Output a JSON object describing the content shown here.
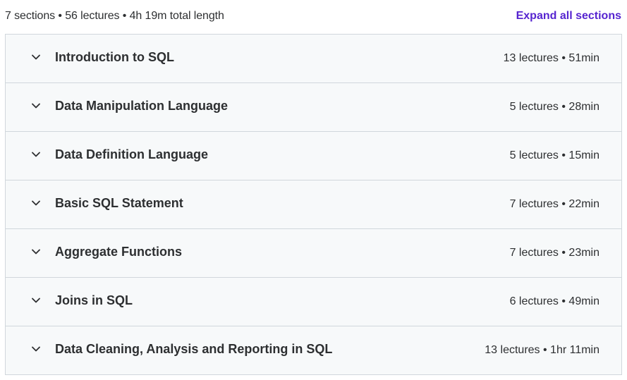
{
  "header": {
    "summary": "7 sections • 56 lectures • 4h 19m total length",
    "expand_label": "Expand all sections"
  },
  "sections": [
    {
      "title": "Introduction to SQL",
      "meta": "13 lectures • 51min"
    },
    {
      "title": "Data Manipulation Language",
      "meta": "5 lectures • 28min"
    },
    {
      "title": "Data Definition Language",
      "meta": "5 lectures • 15min"
    },
    {
      "title": "Basic SQL Statement",
      "meta": "7 lectures • 22min"
    },
    {
      "title": "Aggregate Functions",
      "meta": "7 lectures • 23min"
    },
    {
      "title": "Joins in SQL",
      "meta": "6 lectures • 49min"
    },
    {
      "title": "Data Cleaning, Analysis and Reporting in SQL",
      "meta": "13 lectures • 1hr 11min"
    }
  ],
  "icons": {
    "section_toggle": "chevron-down-icon"
  },
  "colors": {
    "accent": "#5624d0",
    "text": "#2d2f31",
    "section_bg": "#f7f9fa",
    "border": "#d1d7dc"
  }
}
